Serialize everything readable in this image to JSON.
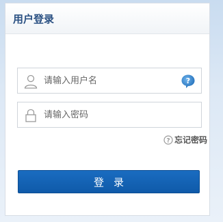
{
  "panel": {
    "title": "用户登录"
  },
  "form": {
    "username_placeholder": "请输入用户名",
    "password_placeholder": "请输入密码",
    "forgot_label": "忘记密码",
    "login_label": "登录"
  },
  "icons": {
    "user": "user-icon",
    "lock": "lock-icon",
    "help": "help-icon",
    "forgot": "question-circle-icon"
  },
  "colors": {
    "title": "#2a5082",
    "button": "#1a6cc0",
    "help_badge": "#2b7ac4"
  }
}
